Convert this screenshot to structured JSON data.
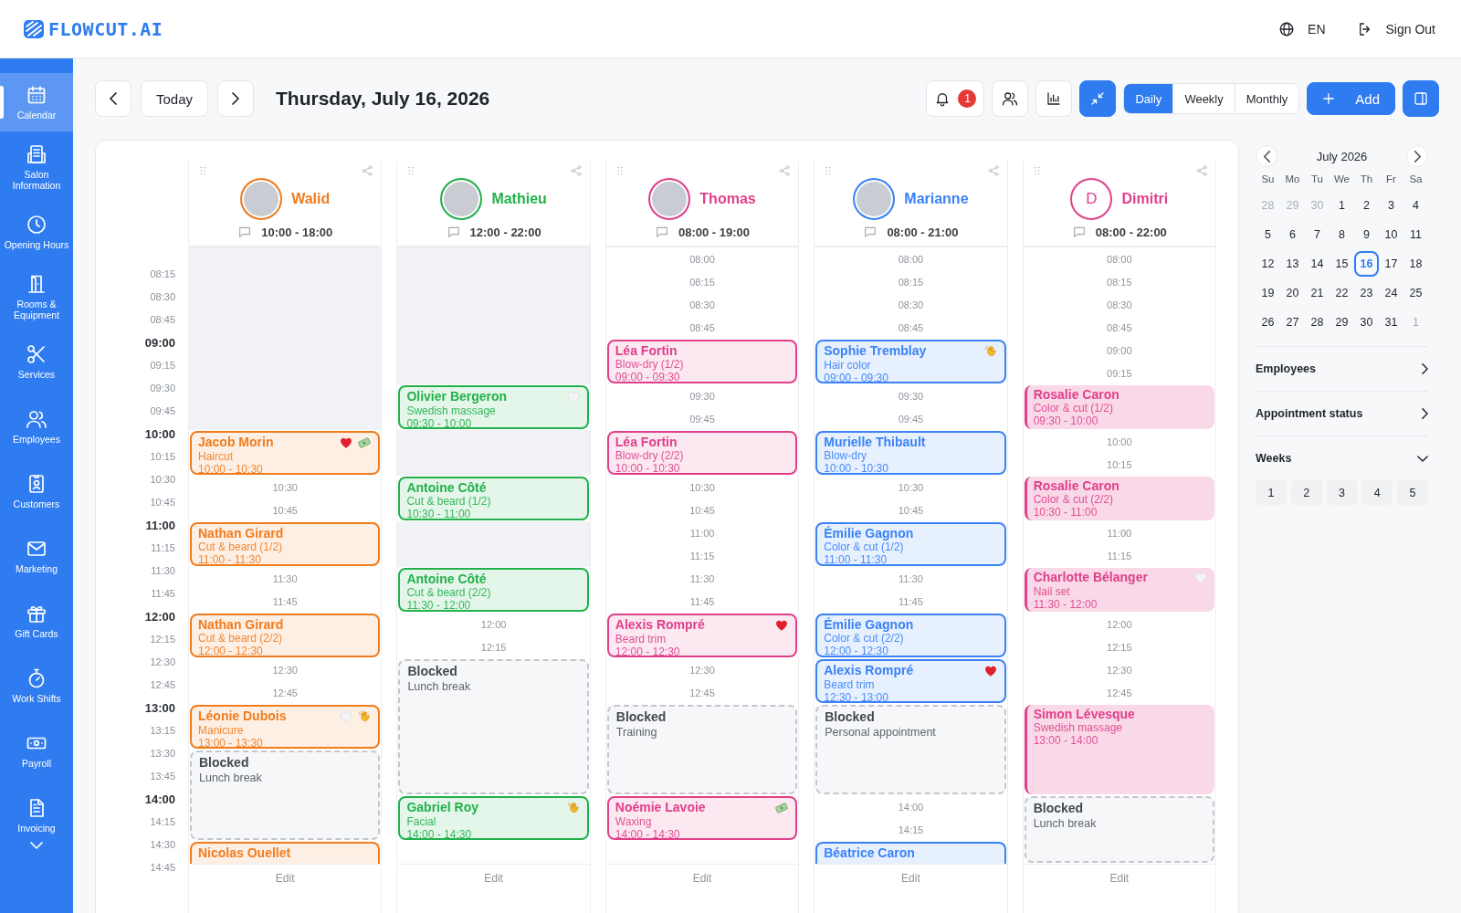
{
  "header": {
    "logo": "FLOWCUT.AI",
    "language": "EN",
    "sign_out": "Sign Out"
  },
  "sidebar": {
    "items": [
      {
        "kind": "calendar",
        "label": "Calendar",
        "selected": true
      },
      {
        "kind": "building",
        "label": "Salon Information",
        "selected": false
      },
      {
        "kind": "clock",
        "label": "Opening Hours",
        "selected": false
      },
      {
        "kind": "door",
        "label": "Rooms & Equipment",
        "selected": false
      },
      {
        "kind": "scissors",
        "label": "Services",
        "selected": false
      },
      {
        "kind": "people",
        "label": "Employees",
        "selected": false
      },
      {
        "kind": "contact",
        "label": "Customers",
        "selected": false
      },
      {
        "kind": "mail",
        "label": "Marketing",
        "selected": false
      },
      {
        "kind": "gift",
        "label": "Gift Cards",
        "selected": false
      },
      {
        "kind": "stopwatch",
        "label": "Work Shifts",
        "selected": false
      },
      {
        "kind": "banknote",
        "label": "Payroll",
        "selected": false
      },
      {
        "kind": "document",
        "label": "Invoicing",
        "selected": false
      }
    ]
  },
  "toolbar": {
    "today": "Today",
    "date": "Thursday, July 16, 2026",
    "tools": [
      {
        "kind": "bell",
        "badge": "1",
        "active": false
      },
      {
        "kind": "people",
        "active": false
      },
      {
        "kind": "chart",
        "active": false
      },
      {
        "kind": "collapse",
        "active": true
      }
    ],
    "views": [
      {
        "label": "Daily",
        "selected": true
      },
      {
        "label": "Weekly",
        "selected": false
      },
      {
        "label": "Monthly",
        "selected": false
      }
    ],
    "add": "Add",
    "panel_toggle": {
      "active": true
    }
  },
  "calendar": {
    "axis": [
      "08:15",
      "08:30",
      "08:45",
      "09:00",
      "09:15",
      "09:30",
      "09:45",
      "10:00",
      "10:15",
      "10:30",
      "10:45",
      "11:00",
      "11:15",
      "11:30",
      "11:45",
      "12:00",
      "12:15",
      "12:30",
      "12:45",
      "13:00",
      "13:15",
      "13:30",
      "13:45",
      "14:00",
      "14:15",
      "14:30",
      "14:45"
    ],
    "employees": [
      {
        "name": "Walid",
        "color": "#f07c1e",
        "avatar": {
          "kind": "photo"
        },
        "hours": "10:00 - 18:00",
        "filled": false,
        "footer": "Edit",
        "slots": [
          {
            "kind": "closed"
          },
          {
            "kind": "appointment",
            "client": "Jacob Morin",
            "service": "Haircut",
            "time": "10:00 - 10:30",
            "badges": [
              {
                "kind": "heart"
              },
              {
                "kind": "banknote"
              }
            ]
          },
          {
            "kind": "time",
            "label": "10:30"
          },
          {
            "kind": "time",
            "label": "10:45"
          },
          {
            "kind": "appointment",
            "client": "Nathan Girard",
            "service": "Cut & beard (1/2)",
            "time": "11:00 - 11:30"
          },
          {
            "kind": "time",
            "label": "11:30"
          },
          {
            "kind": "time",
            "label": "11:45"
          },
          {
            "kind": "appointment",
            "client": "Nathan Girard",
            "service": "Cut & beard (2/2)",
            "time": "12:00 - 12:30"
          },
          {
            "kind": "time",
            "label": "12:30"
          },
          {
            "kind": "time",
            "label": "12:45"
          },
          {
            "kind": "appointment",
            "client": "Léonie Dubois",
            "service": "Manicure",
            "time": "13:00 - 13:30",
            "badges": [
              {
                "kind": "heart_white"
              },
              {
                "kind": "wave"
              }
            ]
          },
          {
            "kind": "blocked",
            "title": "Blocked",
            "note": "Lunch break"
          },
          {
            "kind": "appointment",
            "client": "Nicolas Ouellet"
          }
        ]
      },
      {
        "name": "Mathieu",
        "color": "#22b14c",
        "avatar": {
          "kind": "photo"
        },
        "hours": "12:00 - 22:00",
        "filled": false,
        "footer": "Edit",
        "slots": [
          {
            "kind": "closed"
          },
          {
            "kind": "appointment",
            "client": "Olivier Bergeron",
            "service": "Swedish massage",
            "time": "09:30 - 10:00",
            "badges": [
              {
                "kind": "heart_white"
              }
            ]
          },
          {
            "kind": "closed"
          },
          {
            "kind": "appointment",
            "client": "Antoine Côté",
            "service": "Cut & beard (1/2)",
            "time": "10:30 - 11:00"
          },
          {
            "kind": "closed"
          },
          {
            "kind": "appointment",
            "client": "Antoine Côté",
            "service": "Cut & beard (2/2)",
            "time": "11:30 - 12:00"
          },
          {
            "kind": "time",
            "label": "12:00"
          },
          {
            "kind": "time",
            "label": "12:15"
          },
          {
            "kind": "blocked",
            "title": "Blocked",
            "note": "Lunch break"
          },
          {
            "kind": "appointment",
            "client": "Gabriel Roy",
            "service": "Facial",
            "time": "14:00 - 14:30",
            "badges": [
              {
                "kind": "wave"
              }
            ]
          }
        ]
      },
      {
        "name": "Thomas",
        "color": "#e0408a",
        "avatar": {
          "kind": "photo"
        },
        "hours": "08:00 - 19:00",
        "filled": false,
        "footer": "Edit",
        "slots": [
          {
            "kind": "time",
            "label": "08:00"
          },
          {
            "kind": "time",
            "label": "08:15"
          },
          {
            "kind": "time",
            "label": "08:30"
          },
          {
            "kind": "time",
            "label": "08:45"
          },
          {
            "kind": "appointment",
            "client": "Léa Fortin",
            "service": "Blow-dry (1/2)",
            "time": "09:00 - 09:30"
          },
          {
            "kind": "time",
            "label": "09:30"
          },
          {
            "kind": "time",
            "label": "09:45"
          },
          {
            "kind": "appointment",
            "client": "Léa Fortin",
            "service": "Blow-dry (2/2)",
            "time": "10:00 - 10:30"
          },
          {
            "kind": "time",
            "label": "10:30"
          },
          {
            "kind": "time",
            "label": "10:45"
          },
          {
            "kind": "time",
            "label": "11:00"
          },
          {
            "kind": "time",
            "label": "11:15"
          },
          {
            "kind": "time",
            "label": "11:30"
          },
          {
            "kind": "time",
            "label": "11:45"
          },
          {
            "kind": "appointment",
            "client": "Alexis Rompré",
            "service": "Beard trim",
            "time": "12:00 - 12:30",
            "badges": [
              {
                "kind": "heart"
              }
            ]
          },
          {
            "kind": "time",
            "label": "12:30"
          },
          {
            "kind": "time",
            "label": "12:45"
          },
          {
            "kind": "blocked",
            "title": "Blocked",
            "note": "Training"
          },
          {
            "kind": "appointment",
            "client": "Noémie Lavoie",
            "service": "Waxing",
            "time": "14:00 - 14:30",
            "badges": [
              {
                "kind": "banknote"
              }
            ]
          }
        ]
      },
      {
        "name": "Marianne",
        "color": "#3b82f6",
        "avatar": {
          "kind": "photo"
        },
        "hours": "08:00 - 21:00",
        "filled": false,
        "footer": "Edit",
        "slots": [
          {
            "kind": "time",
            "label": "08:00"
          },
          {
            "kind": "time",
            "label": "08:15"
          },
          {
            "kind": "time",
            "label": "08:30"
          },
          {
            "kind": "time",
            "label": "08:45"
          },
          {
            "kind": "appointment",
            "client": "Sophie Tremblay",
            "service": "Hair color",
            "time": "09:00 - 09:30",
            "badges": [
              {
                "kind": "wave"
              }
            ]
          },
          {
            "kind": "time",
            "label": "09:30"
          },
          {
            "kind": "time",
            "label": "09:45"
          },
          {
            "kind": "appointment",
            "client": "Murielle Thibault",
            "service": "Blow-dry",
            "time": "10:00 - 10:30"
          },
          {
            "kind": "time",
            "label": "10:30"
          },
          {
            "kind": "time",
            "label": "10:45"
          },
          {
            "kind": "appointment",
            "client": "Émilie Gagnon",
            "service": "Color & cut (1/2)",
            "time": "11:00 - 11:30"
          },
          {
            "kind": "time",
            "label": "11:30"
          },
          {
            "kind": "time",
            "label": "11:45"
          },
          {
            "kind": "appointment",
            "client": "Émilie Gagnon",
            "service": "Color & cut (2/2)",
            "time": "12:00 - 12:30"
          },
          {
            "kind": "appointment",
            "client": "Alexis Rompré",
            "service": "Beard trim",
            "time": "12:30 - 13:00",
            "badges": [
              {
                "kind": "heart"
              }
            ]
          },
          {
            "kind": "blocked",
            "title": "Blocked",
            "note": "Personal appointment"
          },
          {
            "kind": "time",
            "label": "14:00"
          },
          {
            "kind": "time",
            "label": "14:15"
          },
          {
            "kind": "appointment",
            "client": "Béatrice Caron"
          }
        ]
      },
      {
        "name": "Dimitri",
        "color": "#e0408a",
        "avatar": {
          "kind": "initial",
          "text": "D"
        },
        "hours": "08:00 - 22:00",
        "filled": true,
        "footer": "Edit",
        "slots": [
          {
            "kind": "time",
            "label": "08:00"
          },
          {
            "kind": "time",
            "label": "08:15"
          },
          {
            "kind": "time",
            "label": "08:30"
          },
          {
            "kind": "time",
            "label": "08:45"
          },
          {
            "kind": "time",
            "label": "09:00"
          },
          {
            "kind": "time",
            "label": "09:15"
          },
          {
            "kind": "appointment",
            "client": "Rosalie Caron",
            "service": "Color & cut (1/2)",
            "time": "09:30 - 10:00"
          },
          {
            "kind": "time",
            "label": "10:00"
          },
          {
            "kind": "time",
            "label": "10:15"
          },
          {
            "kind": "appointment",
            "client": "Rosalie Caron",
            "service": "Color & cut (2/2)",
            "time": "10:30 - 11:00"
          },
          {
            "kind": "time",
            "label": "11:00"
          },
          {
            "kind": "time",
            "label": "11:15"
          },
          {
            "kind": "appointment",
            "client": "Charlotte Bélanger",
            "service": "Nail set",
            "time": "11:30 - 12:00",
            "badges": [
              {
                "kind": "heart_white"
              }
            ]
          },
          {
            "kind": "time",
            "label": "12:00"
          },
          {
            "kind": "time",
            "label": "12:15"
          },
          {
            "kind": "time",
            "label": "12:30"
          },
          {
            "kind": "time",
            "label": "12:45"
          },
          {
            "kind": "appointment",
            "client": "Simon Lévesque",
            "service": "Swedish massage",
            "time": "13:00 - 14:00"
          },
          {
            "kind": "blocked",
            "title": "Blocked",
            "note": "Lunch break"
          }
        ]
      }
    ]
  },
  "mini_calendar": {
    "month": "July 2026",
    "weekdays": [
      "Su",
      "Mo",
      "Tu",
      "We",
      "Th",
      "Fr",
      "Sa"
    ],
    "days": [
      {
        "day": "28",
        "outside": true,
        "selected": false
      },
      {
        "day": "29",
        "outside": true,
        "selected": false
      },
      {
        "day": "30",
        "outside": true,
        "selected": false
      },
      {
        "day": "1",
        "outside": false,
        "selected": false
      },
      {
        "day": "2",
        "outside": false,
        "selected": false
      },
      {
        "day": "3",
        "outside": false,
        "selected": false
      },
      {
        "day": "4",
        "outside": false,
        "selected": false
      },
      {
        "day": "5",
        "outside": false,
        "selected": false
      },
      {
        "day": "6",
        "outside": false,
        "selected": false
      },
      {
        "day": "7",
        "outside": false,
        "selected": false
      },
      {
        "day": "8",
        "outside": false,
        "selected": false
      },
      {
        "day": "9",
        "outside": false,
        "selected": false
      },
      {
        "day": "10",
        "outside": false,
        "selected": false
      },
      {
        "day": "11",
        "outside": false,
        "selected": false
      },
      {
        "day": "12",
        "outside": false,
        "selected": false
      },
      {
        "day": "13",
        "outside": false,
        "selected": false
      },
      {
        "day": "14",
        "outside": false,
        "selected": false
      },
      {
        "day": "15",
        "outside": false,
        "selected": false
      },
      {
        "day": "16",
        "outside": false,
        "selected": true
      },
      {
        "day": "17",
        "outside": false,
        "selected": false
      },
      {
        "day": "18",
        "outside": false,
        "selected": false
      },
      {
        "day": "19",
        "outside": false,
        "selected": false
      },
      {
        "day": "20",
        "outside": false,
        "selected": false
      },
      {
        "day": "21",
        "outside": false,
        "selected": false
      },
      {
        "day": "22",
        "outside": false,
        "selected": false
      },
      {
        "day": "23",
        "outside": false,
        "selected": false
      },
      {
        "day": "24",
        "outside": false,
        "selected": false
      },
      {
        "day": "25",
        "outside": false,
        "selected": false
      },
      {
        "day": "26",
        "outside": false,
        "selected": false
      },
      {
        "day": "27",
        "outside": false,
        "selected": false
      },
      {
        "day": "28",
        "outside": false,
        "selected": false
      },
      {
        "day": "29",
        "outside": false,
        "selected": false
      },
      {
        "day": "30",
        "outside": false,
        "selected": false
      },
      {
        "day": "31",
        "outside": false,
        "selected": false
      },
      {
        "day": "1",
        "outside": true,
        "selected": false
      }
    ]
  },
  "filters": [
    {
      "label": "Employees",
      "expanded": false
    },
    {
      "label": "Appointment status",
      "expanded": false
    },
    {
      "label": "Weeks",
      "expanded": true,
      "options": [
        "1",
        "2",
        "3",
        "4",
        "5"
      ]
    }
  ]
}
